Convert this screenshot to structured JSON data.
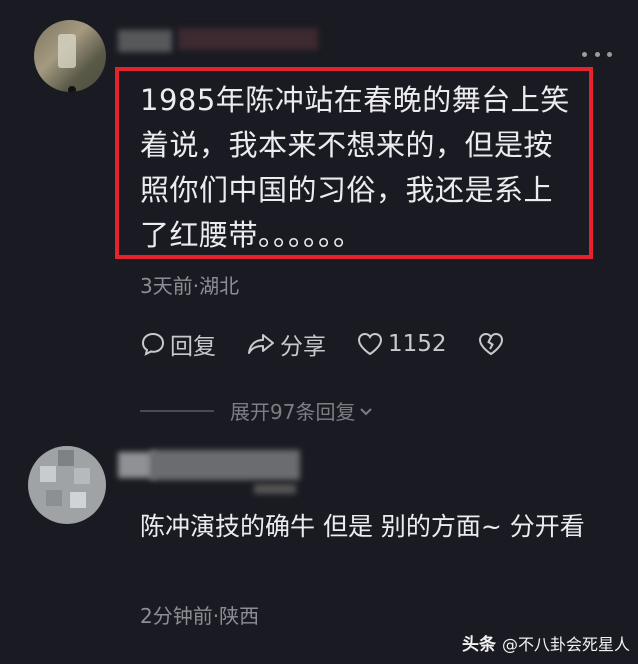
{
  "comment1": {
    "text": "1985年陈冲站在春晚的舞台上笑着说，我本来不想来的，但是按照你们中国的习俗，我还是系上了红腰带。。。。。。",
    "meta": "3天前·湖北",
    "actions": {
      "reply_label": "回复",
      "share_label": "分享",
      "like_count": "1152"
    },
    "expand_label": "展开97条回复"
  },
  "comment2": {
    "text": "陈冲演技的确牛 但是 别的方面~ 分开看",
    "meta": "2分钟前·陕西"
  },
  "watermark": {
    "brand": "头条",
    "handle": "@不八卦会死星人"
  },
  "colors": {
    "background": "#1a1b22",
    "highlight_border": "#e4232e",
    "text": "#ececef",
    "meta_text": "#8d8e95"
  }
}
